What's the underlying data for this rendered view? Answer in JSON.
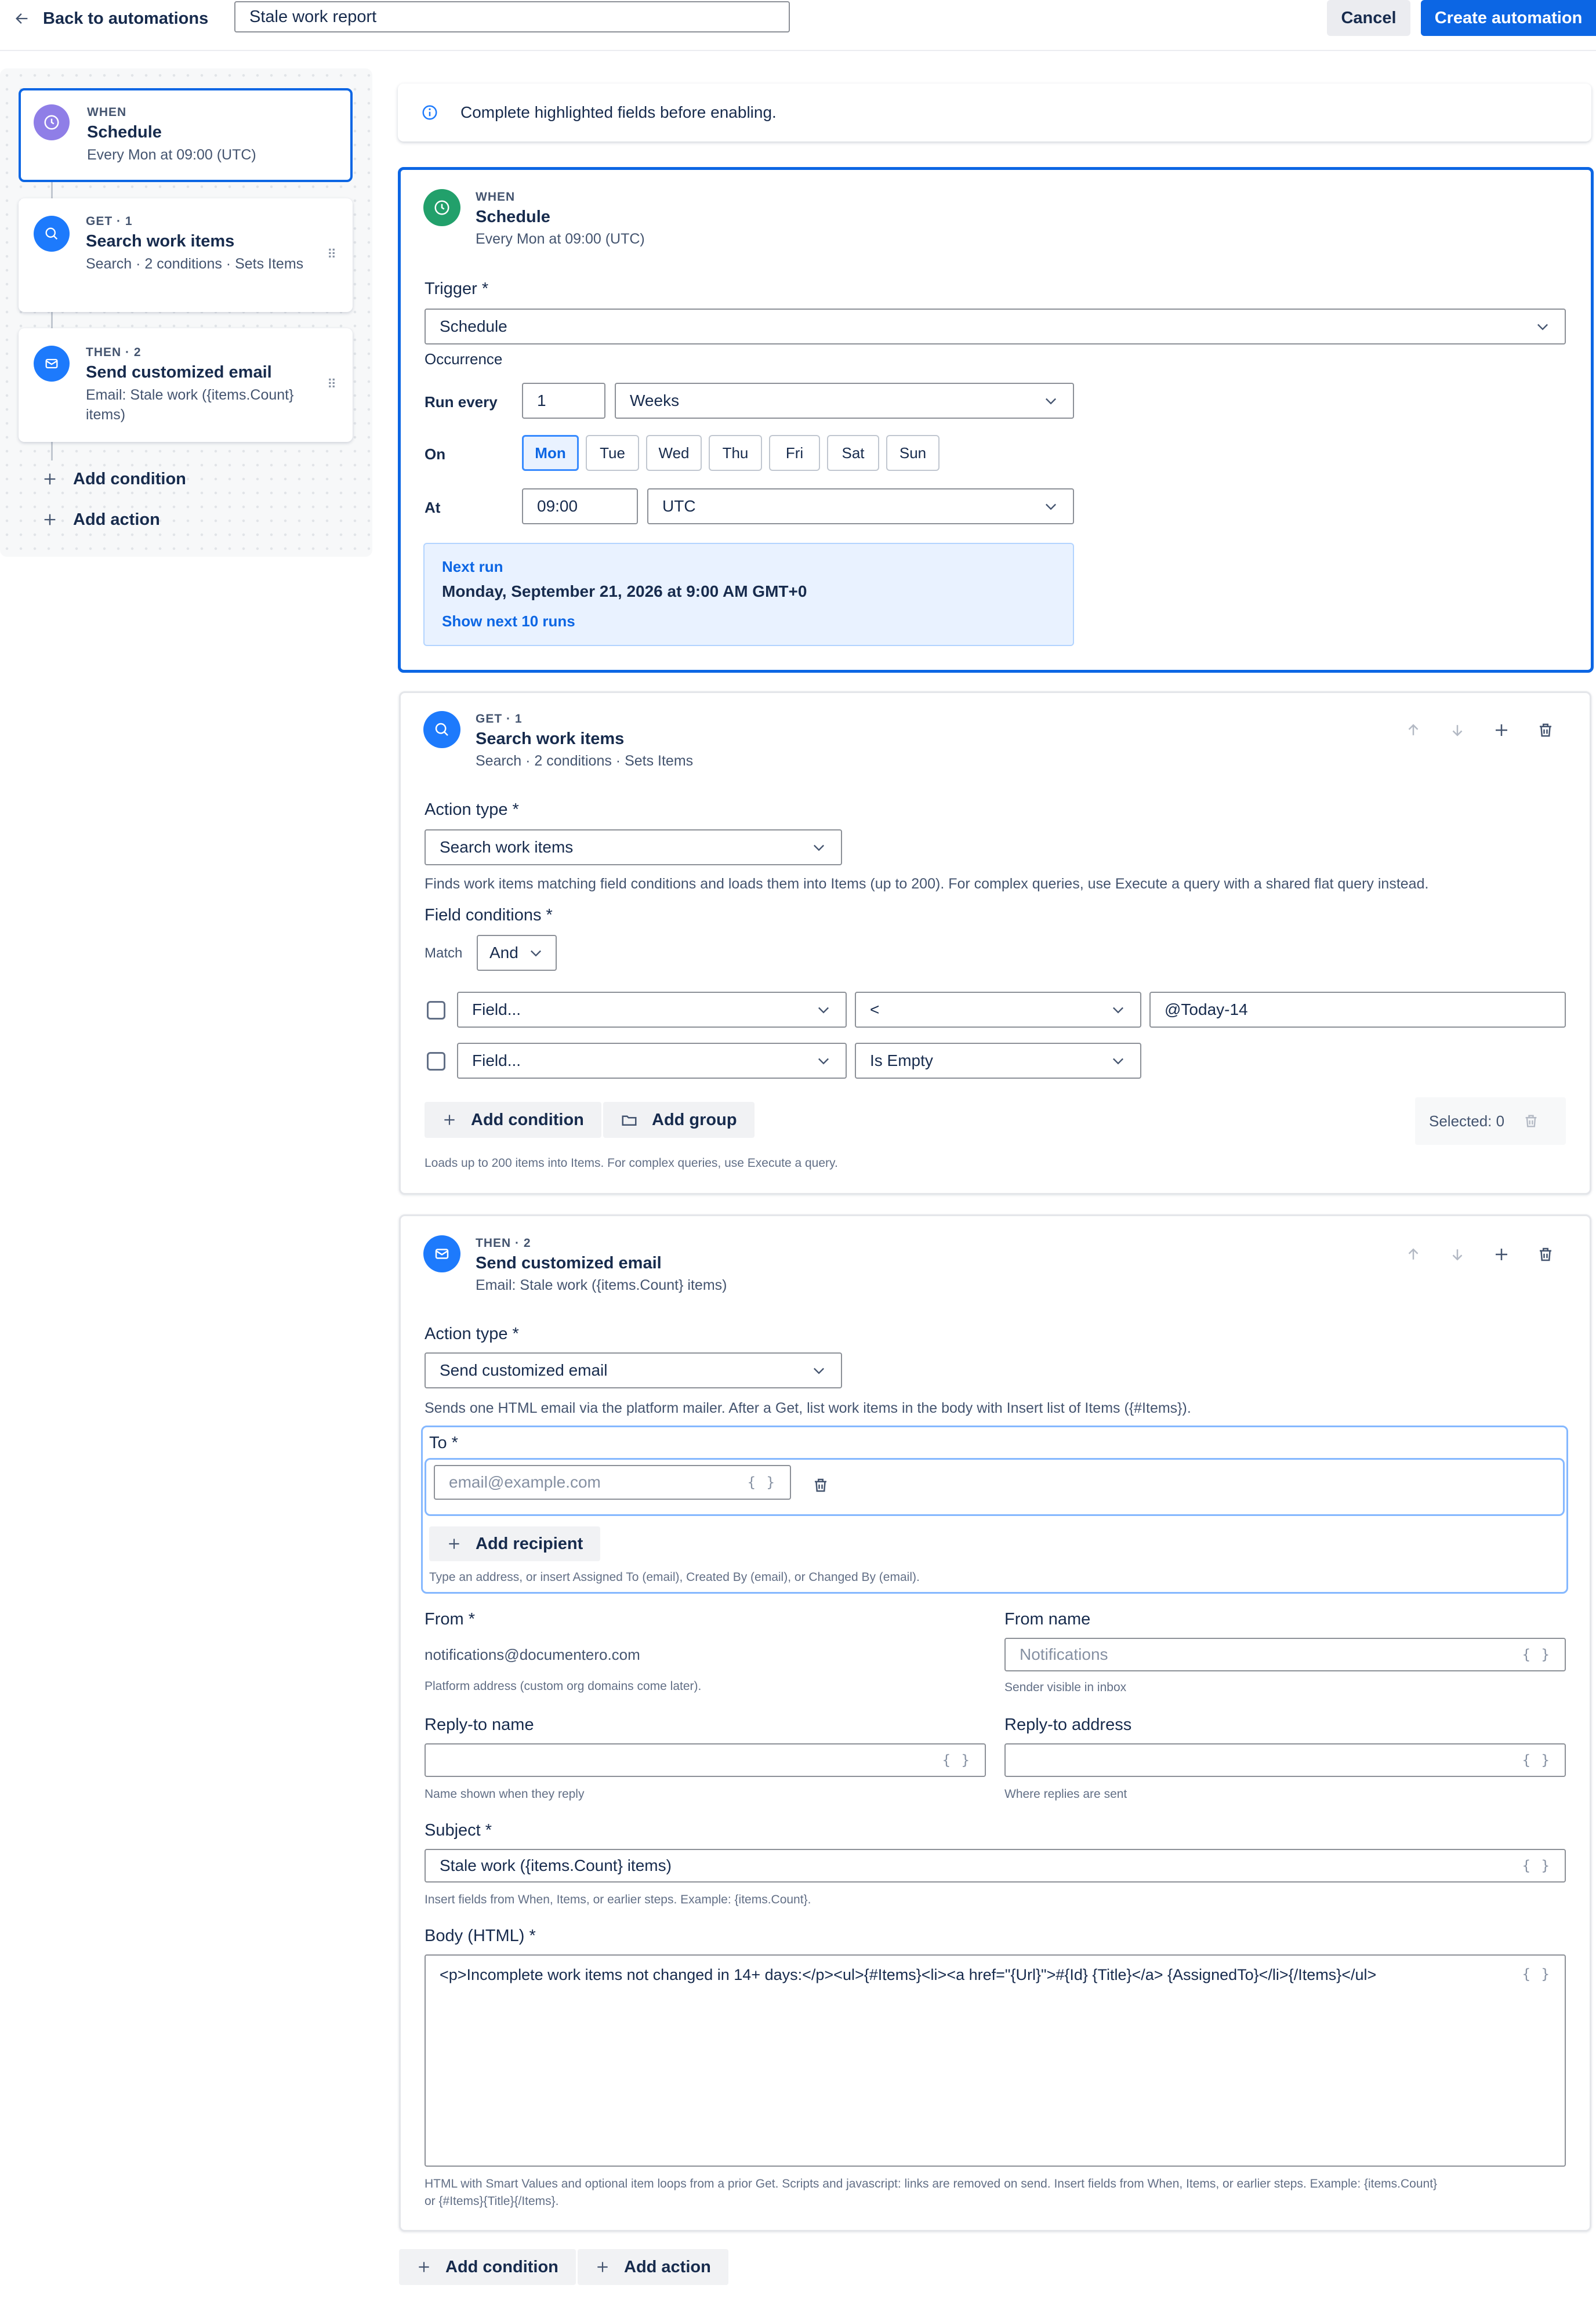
{
  "header": {
    "back_label": "Back to automations",
    "automation_name": "Stale work report",
    "cancel_label": "Cancel",
    "create_label": "Create automation"
  },
  "colors": {
    "primary": "#0c66e4",
    "when_icon_purple": "#8f7ee7",
    "when_icon_green": "#22a06b",
    "step_icon_blue": "#1d7afc"
  },
  "sidebar": {
    "when": {
      "kicker": "WHEN",
      "title": "Schedule",
      "subtitle": "Every Mon at 09:00 (UTC)",
      "icon": "clock-icon"
    },
    "get": {
      "kicker": "GET · 1",
      "title": "Search work items",
      "subtitle": "Search · 2 conditions · Sets Items",
      "icon": "search-icon"
    },
    "then": {
      "kicker": "THEN · 2",
      "title": "Send customized email",
      "subtitle": "Email: Stale work ({items.Count} items)",
      "icon": "mail-icon"
    },
    "add_condition": "Add condition",
    "add_action": "Add action"
  },
  "banner": {
    "text": "Complete highlighted fields before enabling.",
    "icon": "info-icon"
  },
  "when_panel": {
    "kicker": "WHEN",
    "title": "Schedule",
    "subtitle": "Every Mon at 09:00 (UTC)",
    "trigger_label": "Trigger *",
    "trigger_value": "Schedule",
    "occurrence_label": "Occurrence",
    "run_every_label": "Run every",
    "run_every_value": "1",
    "run_every_unit": "Weeks",
    "on_label": "On",
    "days": [
      "Mon",
      "Tue",
      "Wed",
      "Thu",
      "Fri",
      "Sat",
      "Sun"
    ],
    "selected_day": "Mon",
    "at_label": "At",
    "time_value": "09:00",
    "timezone": "UTC",
    "next_run_label": "Next run",
    "next_run_value": "Monday, September 21, 2026 at 9:00 AM GMT+0",
    "show_next_label": "Show next 10 runs"
  },
  "get_panel": {
    "kicker": "GET · 1",
    "title": "Search work items",
    "subtitle": "Search · 2 conditions · Sets Items",
    "action_type_label": "Action type *",
    "action_type_value": "Search work items",
    "description": "Finds work items matching field conditions and loads them into Items (up to 200). For complex queries, use Execute a query with a shared flat query instead.",
    "field_conditions_label": "Field conditions *",
    "match_label": "Match",
    "match_value": "And",
    "conditions": [
      {
        "field": "Field...",
        "operator": "<",
        "value": "@Today-14"
      },
      {
        "field": "Field...",
        "operator": "Is Empty",
        "value": ""
      }
    ],
    "add_condition_label": "Add condition",
    "add_group_label": "Add group",
    "selected_label": "Selected: 0",
    "footer_help": "Loads up to 200 items into Items. For complex queries, use Execute a query."
  },
  "then_panel": {
    "kicker": "THEN · 2",
    "title": "Send customized email",
    "subtitle": "Email: Stale work ({items.Count} items)",
    "action_type_label": "Action type *",
    "action_type_value": "Send customized email",
    "description": "Sends one HTML email via the platform mailer. After a Get, list work items in the body with Insert list of Items ({#Items}).",
    "to_label": "To *",
    "to_placeholder": "email@example.com",
    "add_recipient_label": "Add recipient",
    "to_help": "Type an address, or insert Assigned To (email), Created By (email), or Changed By (email).",
    "from_label": "From *",
    "from_value": "notifications@documentero.com",
    "from_help": "Platform address (custom org domains come later).",
    "from_name_label": "From name",
    "from_name_placeholder": "Notifications",
    "from_name_help": "Sender visible in inbox",
    "reply_name_label": "Reply-to name",
    "reply_name_help": "Name shown when they reply",
    "reply_address_label": "Reply-to address",
    "reply_address_help": "Where replies are sent",
    "subject_label": "Subject *",
    "subject_value": "Stale work ({items.Count} items)",
    "subject_help": "Insert fields from When, Items, or earlier steps. Example: {items.Count}.",
    "body_label": "Body (HTML) *",
    "body_value": "<p>Incomplete work items not changed in 14+ days:</p><ul>{#Items}<li><a href=\"{Url}\">#{Id} {Title}</a> {AssignedTo}</li>{/Items}</ul>",
    "body_help_1": "HTML with Smart Values and optional item loops from a prior Get. Scripts and javascript: links are removed on send. Insert fields from When, Items, or earlier steps. Example: {items.Count}",
    "body_help_2": "or {#Items}{Title}{/Items}.",
    "smart_value_glyph": "{ }"
  },
  "footer": {
    "add_condition_label": "Add condition",
    "add_action_label": "Add action"
  }
}
